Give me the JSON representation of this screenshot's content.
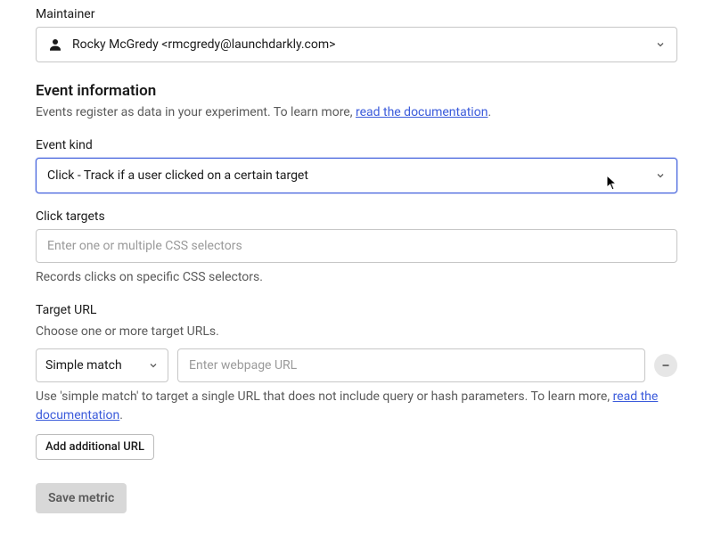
{
  "maintainer": {
    "label": "Maintainer",
    "value": "Rocky McGredy <rmcgredy@launchdarkly.com>"
  },
  "event_info": {
    "heading": "Event information",
    "help_prefix": "Events register as data in your experiment. To learn more, ",
    "help_link": "read the documentation",
    "help_suffix": "."
  },
  "event_kind": {
    "label": "Event kind",
    "value": "Click - Track if a user clicked on a certain target"
  },
  "click_targets": {
    "label": "Click targets",
    "placeholder": "Enter one or multiple CSS selectors",
    "help": "Records clicks on specific CSS selectors."
  },
  "target_url": {
    "label": "Target URL",
    "sub": "Choose one or more target URLs.",
    "match_mode": "Simple match",
    "placeholder": "Enter webpage URL",
    "help_prefix": "Use 'simple match' to target a single URL that does not include query or hash parameters. To learn more, ",
    "help_link": "read the documentation",
    "help_suffix": "."
  },
  "buttons": {
    "add_url": "Add additional URL",
    "save": "Save metric"
  }
}
